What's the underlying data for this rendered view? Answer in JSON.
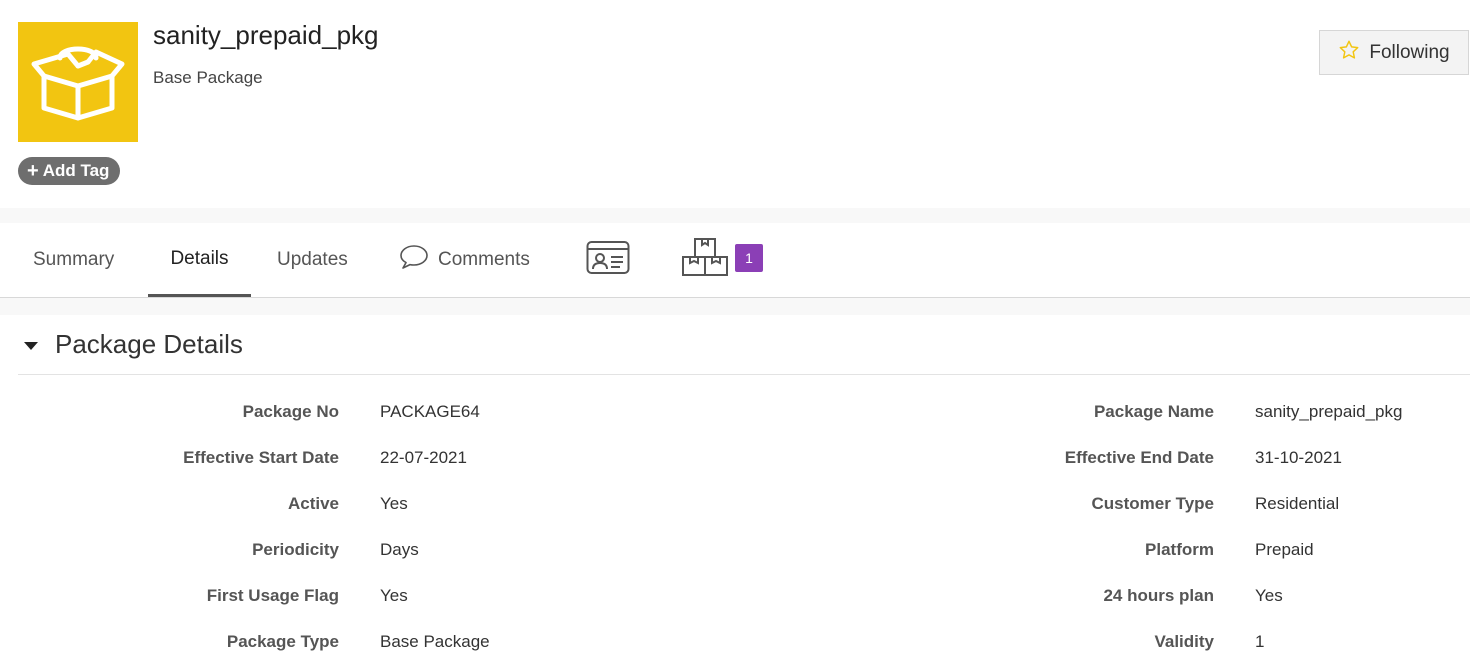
{
  "header": {
    "title": "sanity_prepaid_pkg",
    "subtitle": "Base Package",
    "icon": "package-box-icon",
    "icon_bg": "#f2c511",
    "add_tag_label": "Add Tag",
    "follow_label": "Following"
  },
  "tabs": [
    {
      "label": "Summary"
    },
    {
      "label": "Details",
      "active": true
    },
    {
      "label": "Updates"
    },
    {
      "label": "Comments",
      "icon": "speech-bubble-icon"
    },
    {
      "label": "",
      "icon": "contact-card-icon"
    },
    {
      "label": "",
      "icon": "stacked-boxes-icon",
      "badge": "1"
    }
  ],
  "badge_color": "#8b3fb6",
  "section": {
    "title": "Package Details",
    "fields_left": [
      {
        "label": "Package No",
        "value": "PACKAGE64"
      },
      {
        "label": "Effective Start Date",
        "value": "22-07-2021"
      },
      {
        "label": "Active",
        "value": "Yes"
      },
      {
        "label": "Periodicity",
        "value": "Days"
      },
      {
        "label": "First Usage Flag",
        "value": "Yes"
      },
      {
        "label": "Package Type",
        "value": "Base Package"
      }
    ],
    "fields_right": [
      {
        "label": "Package Name",
        "value": "sanity_prepaid_pkg"
      },
      {
        "label": "Effective End Date",
        "value": "31-10-2021"
      },
      {
        "label": "Customer Type",
        "value": "Residential"
      },
      {
        "label": "Platform",
        "value": "Prepaid"
      },
      {
        "label": "24 hours plan",
        "value": "Yes"
      },
      {
        "label": "Validity",
        "value": "1"
      }
    ]
  }
}
